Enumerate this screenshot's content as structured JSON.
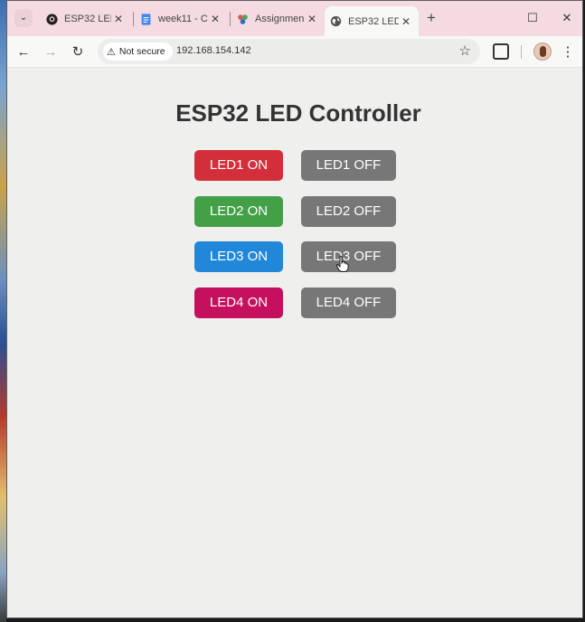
{
  "tabs": [
    {
      "title": "ESP32 LED",
      "favicon": "github-icon",
      "active": false
    },
    {
      "title": "week11 - C",
      "favicon": "google-docs-icon",
      "active": false
    },
    {
      "title": "Assignmen",
      "favicon": "app-icon",
      "active": false
    },
    {
      "title": "ESP32 LED",
      "favicon": "globe-icon",
      "active": true
    }
  ],
  "addressbar": {
    "security_label": "Not secure",
    "url": "192.168.154.142"
  },
  "page": {
    "title": "ESP32 LED Controller",
    "leds": [
      {
        "on_label": "LED1 ON",
        "off_label": "LED1 OFF",
        "on_color": "#d32f3a"
      },
      {
        "on_label": "LED2 ON",
        "off_label": "LED2 OFF",
        "on_color": "#43a047"
      },
      {
        "on_label": "LED3 ON",
        "off_label": "LED3 OFF",
        "on_color": "#2187d9"
      },
      {
        "on_label": "LED4 ON",
        "off_label": "LED4 OFF",
        "on_color": "#c4105f"
      }
    ],
    "off_color": "#777777"
  }
}
